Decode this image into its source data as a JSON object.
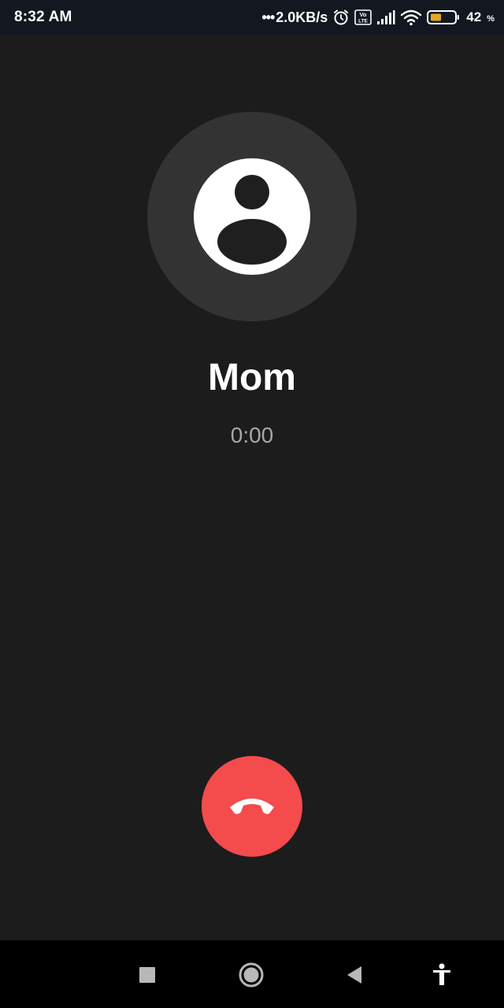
{
  "status_bar": {
    "time": "8:32 AM",
    "dots": "•••",
    "network_speed": "2.0KB/s",
    "battery_level": "42",
    "battery_unit": "%",
    "volte_label_top": "Vo",
    "volte_label_bottom": "LTE",
    "icons": [
      "alarm-icon",
      "volte-icon",
      "signal-icon",
      "wifi-icon",
      "battery-icon"
    ]
  },
  "call": {
    "contact_name": "Mom",
    "timer": "0:00"
  },
  "end_call": {
    "icon": "phone-hangup-icon",
    "color": "#f44b4d"
  },
  "nav_bar": {
    "buttons": [
      "recents-button",
      "home-button",
      "back-button",
      "accessibility-button"
    ]
  },
  "colors": {
    "background": "#1c1c1c",
    "avatar_ring": "#333333",
    "timer_text": "#a8a8a8"
  }
}
